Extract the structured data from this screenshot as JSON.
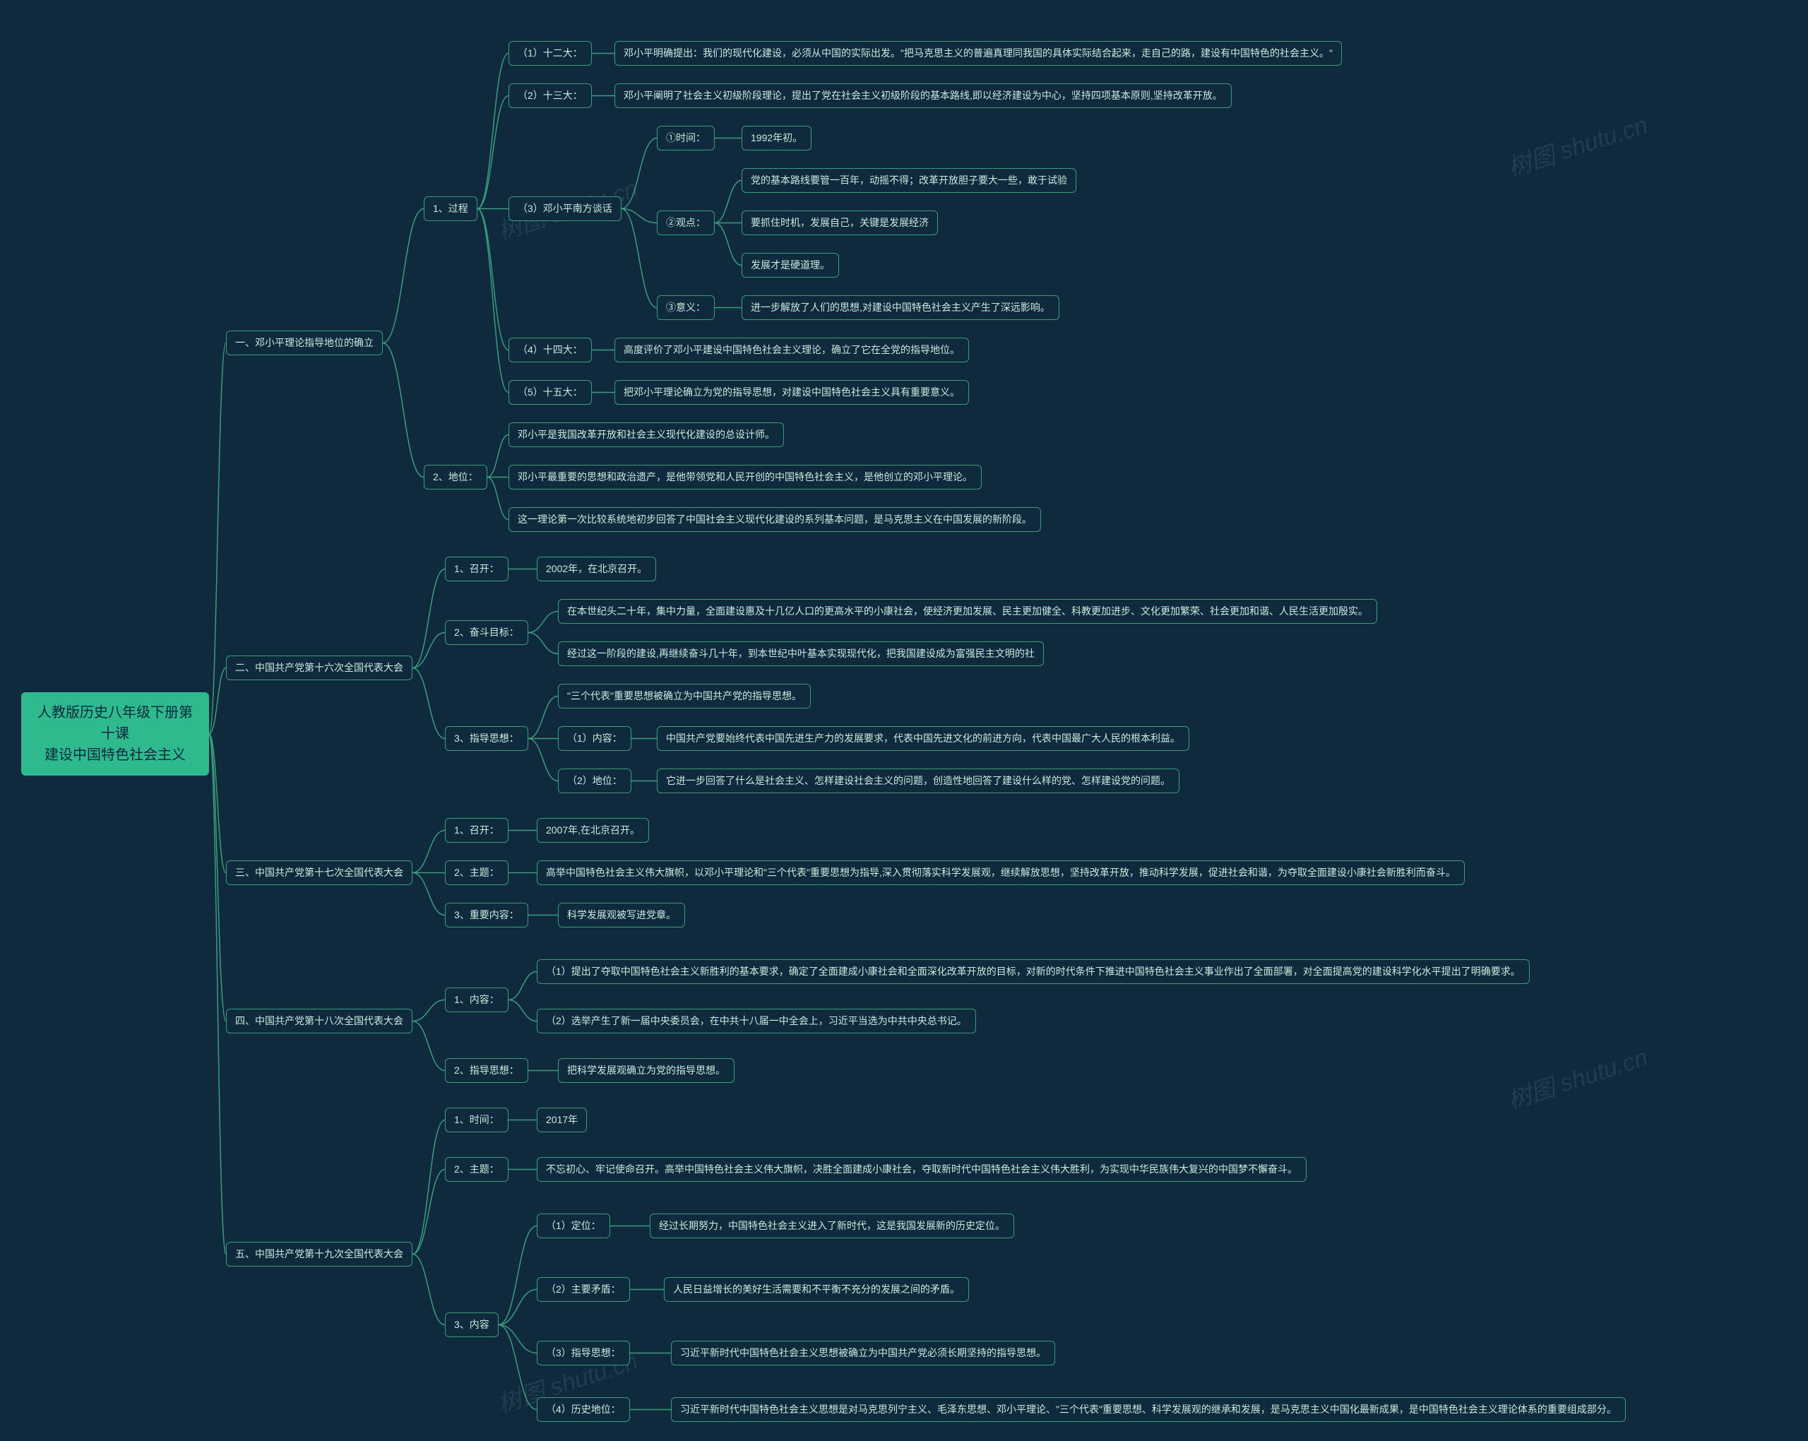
{
  "watermark": "树图 shutu.cn",
  "root": {
    "title_line1": "人教版历史八年级下册第十课",
    "title_line2": "建设中国特色社会主义"
  },
  "s1": {
    "title": "一、邓小平理论指导地位的确立",
    "process": {
      "label": "1、过程",
      "i1": {
        "label": "（1）十二大：",
        "text": "邓小平明确提出：我们的现代化建设，必须从中国的实际出发。\"把马克思主义的普遍真理同我国的具体实际结合起来，走自己的路，建设有中国特色的社会主义。\""
      },
      "i2": {
        "label": "（2）十三大：",
        "text": "邓小平阐明了社会主义初级阶段理论，提出了党在社会主义初级阶段的基本路线,即以经济建设为中心，坚持四项基本原则,坚持改革开放。"
      },
      "i3": {
        "label": "（3）邓小平南方谈话",
        "time": {
          "label": "①时间：",
          "text": "1992年初。"
        },
        "view": {
          "label": "②观点：",
          "v1": "党的基本路线要管一百年，动摇不得；改革开放胆子要大一些，敢于试验",
          "v2": "要抓住时机，发展自己，关键是发展经济",
          "v3": "发展才是硬道理。"
        },
        "sig": {
          "label": "③意义：",
          "text": "进一步解放了人们的思想,对建设中国特色社会主义产生了深远影响。"
        }
      },
      "i4": {
        "label": "（4）十四大：",
        "text": "高度评价了邓小平建设中国特色社会主义理论，确立了它在全党的指导地位。"
      },
      "i5": {
        "label": "（5）十五大：",
        "text": "把邓小平理论确立为党的指导思想，对建设中国特色社会主义具有重要意义。"
      }
    },
    "status": {
      "label": "2、地位：",
      "t1": "邓小平是我国改革开放和社会主义现代化建设的总设计师。",
      "t2": "邓小平最重要的思想和政治遗产，是他带领党和人民开创的中国特色社会主义，是他创立的邓小平理论。",
      "t3": "这一理论第一次比较系统地初步回答了中国社会主义现代化建设的系列基本问题，是马克思主义在中国发展的新阶段。"
    }
  },
  "s2": {
    "title": "二、中国共产党第十六次全国代表大会",
    "held": {
      "label": "1、召开：",
      "text": "2002年，在北京召开。"
    },
    "goal": {
      "label": "2、奋斗目标：",
      "t1": "在本世纪头二十年，集中力量，全面建设惠及十几亿人口的更高水平的小康社会，使经济更加发展、民主更加健全、科教更加进步、文化更加繁荣、社会更加和谐、人民生活更加殷实。",
      "t2": "经过这一阶段的建设,再继续奋斗几十年，到本世纪中叶基本实现现代化，把我国建设成为富强民主文明的社"
    },
    "guide": {
      "label": "3、指导思想：",
      "t0": "\"三个代表\"重要思想被确立为中国共产党的指导思想。",
      "c1": {
        "label": "（1）内容：",
        "text": "中国共产党要始终代表中国先进生产力的发展要求，代表中国先进文化的前进方向，代表中国最广大人民的根本利益。"
      },
      "c2": {
        "label": "（2）地位：",
        "text": "它进一步回答了什么是社会主义、怎样建设社会主义的问题，创造性地回答了建设什么样的党、怎样建设党的问题。"
      }
    }
  },
  "s3": {
    "title": "三、中国共产党第十七次全国代表大会",
    "held": {
      "label": "1、召开：",
      "text": "2007年,在北京召开。"
    },
    "theme": {
      "label": "2、主题：",
      "text": "高举中国特色社会主义伟大旗帜，以邓小平理论和\"三个代表\"重要思想为指导,深入贯彻落实科学发展观，继续解放思想，坚持改革开放，推动科学发展，促进社会和谐，为夺取全面建设小康社会新胜利而奋斗。"
    },
    "content": {
      "label": "3、重要内容：",
      "text": "科学发展观被写进党章。"
    }
  },
  "s4": {
    "title": "四、中国共产党第十八次全国代表大会",
    "content": {
      "label": "1、内容：",
      "t1": "（1）提出了夺取中国特色社会主义新胜利的基本要求，确定了全面建成小康社会和全面深化改革开放的目标，对新的时代条件下推进中国特色社会主义事业作出了全面部署，对全面提高党的建设科学化水平提出了明确要求。",
      "t2": "（2）选举产生了新一届中央委员会，在中共十八届一中全会上，习近平当选为中共中央总书记。"
    },
    "guide": {
      "label": "2、指导思想：",
      "text": "把科学发展观确立为党的指导思想。"
    }
  },
  "s5": {
    "title": "五、中国共产党第十九次全国代表大会",
    "time": {
      "label": "1、时间：",
      "text": "2017年"
    },
    "theme": {
      "label": "2、主题：",
      "text": "不忘初心、牢记使命召开。高举中国特色社会主义伟大旗帜，决胜全面建成小康社会，夺取新时代中国特色社会主义伟大胜利，为实现中华民族伟大复兴的中国梦不懈奋斗。"
    },
    "content": {
      "label": "3、内容",
      "c1": {
        "label": "（1）定位：",
        "text": "经过长期努力，中国特色社会主义进入了新时代，这是我国发展新的历史定位。"
      },
      "c2": {
        "label": "（2）主要矛盾：",
        "text": "人民日益增长的美好生活需要和不平衡不充分的发展之间的矛盾。"
      },
      "c3": {
        "label": "（3）指导思想：",
        "text": "习近平新时代中国特色社会主义思想被确立为中国共产党必须长期坚持的指导思想。"
      },
      "c4": {
        "label": "（4）历史地位：",
        "text": "习近平新时代中国特色社会主义思想是对马克思列宁主义、毛泽东思想、邓小平理论、\"三个代表\"重要思想、科学发展观的继承和发展，是马克思主义中国化最新成果，是中国特色社会主义理论体系的重要组成部分。"
      }
    }
  }
}
